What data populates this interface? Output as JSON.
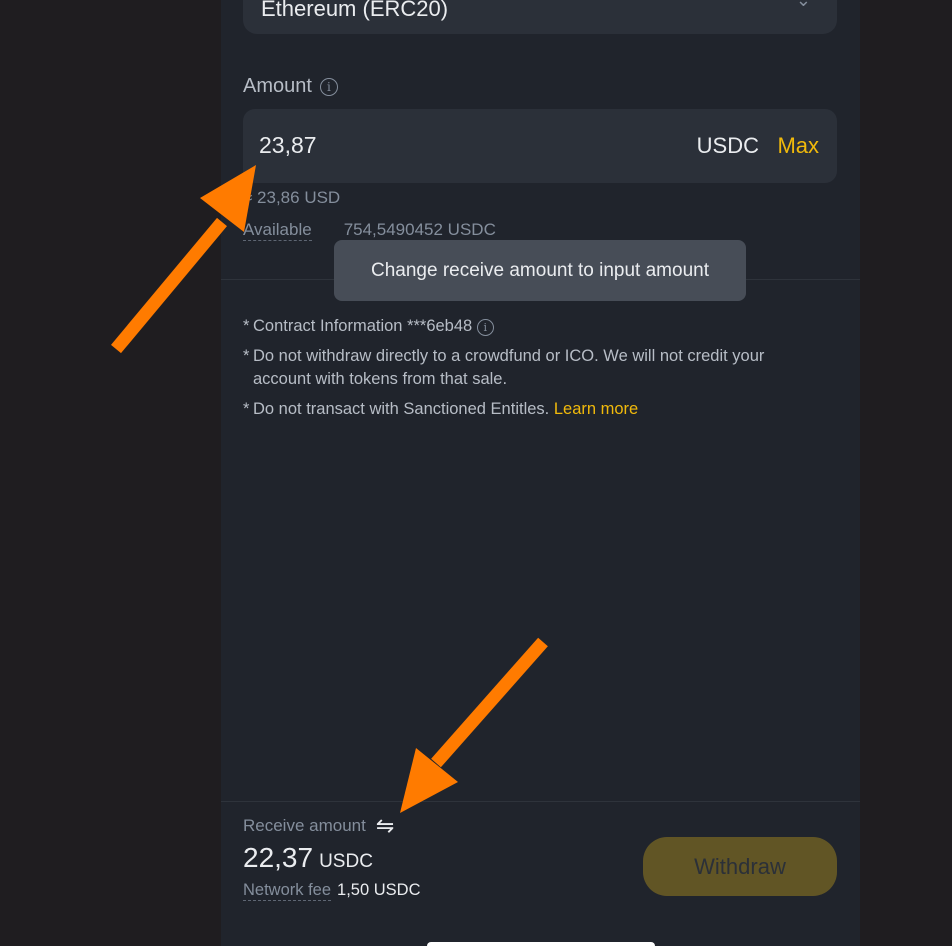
{
  "network": {
    "value": "Ethereum (ERC20)",
    "chevron_icon": "chevron-down-icon"
  },
  "amount": {
    "label": "Amount",
    "info_icon": "info-icon",
    "input_value": "23,87",
    "unit": "USDC",
    "max_label": "Max",
    "usd_equiv": "≈ 23,86 USD",
    "available_label": "Available",
    "available_value": "754,5490452 USDC"
  },
  "tooltip": {
    "text": "Change receive amount to input amount"
  },
  "notes": {
    "contract_info": "Contract Information ***6eb48",
    "warning_ico": "Do not withdraw directly to a crowdfund or ICO. We will not credit your account with tokens from that sale.",
    "warning_sanctions": "Do not transact with Sanctioned Entitles.",
    "learn_more": "Learn more",
    "bullet": "*"
  },
  "receive": {
    "label": "Receive amount",
    "swap_icon": "swap-arrows-icon",
    "value": "22,37",
    "unit": "USDC",
    "fee_label": "Network fee",
    "fee_value": "1,50 USDC"
  },
  "actions": {
    "withdraw_label": "Withdraw"
  },
  "colors": {
    "accent": "#f0b90b",
    "annotation_arrow": "#ff7b00",
    "background": "#20242c"
  }
}
